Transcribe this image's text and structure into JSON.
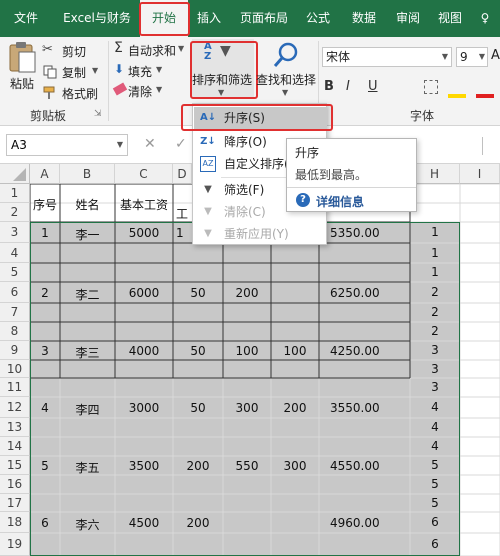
{
  "tabs": [
    "文件",
    "Excel与财务",
    "开始",
    "插入",
    "页面布局",
    "公式",
    "数据",
    "审阅",
    "视图",
    "♀"
  ],
  "ribbon": {
    "clipboard": {
      "paste": "粘贴",
      "cut": "剪切",
      "copy": "复制",
      "format_painter": "格式刷",
      "group": "剪贴板"
    },
    "editing": {
      "autosum": "自动求和",
      "fill": "填充",
      "clear": "清除",
      "sort_filter": "排序和筛选",
      "find_select": "查找和选择"
    },
    "font": {
      "name": "宋体",
      "size": "9",
      "grow": "A",
      "shrink": "A",
      "group": "字体"
    }
  },
  "formula_bar": {
    "name_box": "A3",
    "cancel": "✕",
    "confirm": "✓"
  },
  "columns": [
    "A",
    "B",
    "C",
    "D",
    "E",
    "F",
    "G",
    "H",
    "I"
  ],
  "rows": [
    "1",
    "2",
    "3",
    "4",
    "5",
    "6",
    "7",
    "8",
    "9",
    "10",
    "11",
    "12",
    "13",
    "14",
    "15",
    "16",
    "17",
    "18",
    "19"
  ],
  "headers": {
    "a": "序号",
    "b": "姓名",
    "c": "基本工资",
    "d_partial": "工"
  },
  "records": [
    {
      "row": "3",
      "seq": "1",
      "name": "李一",
      "base": "5000",
      "d": "1",
      "e": "",
      "f": "",
      "g": "5350.00",
      "h": "1"
    },
    {
      "row": "6",
      "seq": "2",
      "name": "李二",
      "base": "6000",
      "d": "50",
      "e": "200",
      "f": "",
      "g": "6250.00",
      "h": "2"
    },
    {
      "row": "9",
      "seq": "3",
      "name": "李三",
      "base": "4000",
      "d": "50",
      "e": "100",
      "f": "100",
      "g": "4250.00",
      "h": "3"
    },
    {
      "row": "12",
      "seq": "4",
      "name": "李四",
      "base": "3000",
      "d": "50",
      "e": "300",
      "f": "200",
      "g": "3550.00",
      "h": "4"
    },
    {
      "row": "15",
      "seq": "5",
      "name": "李五",
      "base": "3500",
      "d": "200",
      "e": "550",
      "f": "300",
      "g": "4550.00",
      "h": "5"
    },
    {
      "row": "18",
      "seq": "6",
      "name": "李六",
      "base": "4500",
      "d": "200",
      "e": "",
      "f": "",
      "g": "4960.00",
      "h": "6"
    }
  ],
  "h_column": [
    "1",
    "1",
    "1",
    "2",
    "2",
    "2",
    "3",
    "3",
    "3",
    "4",
    "4",
    "4",
    "5",
    "5",
    "5",
    "6",
    "6"
  ],
  "menu": {
    "items": [
      {
        "label": "升序(S)"
      },
      {
        "label": "降序(O)"
      },
      {
        "label": "自定义排序(U)..."
      },
      {
        "label": "筛选(F)"
      },
      {
        "label": "清除(C)"
      },
      {
        "label": "重新应用(Y)"
      }
    ]
  },
  "tooltip": {
    "title": "升序",
    "desc": "最低到最高。",
    "link": "详细信息"
  },
  "colors": {
    "excel_green": "#217346",
    "highlight_red": "#e03030",
    "selection_gray": "#c8c8c8"
  }
}
